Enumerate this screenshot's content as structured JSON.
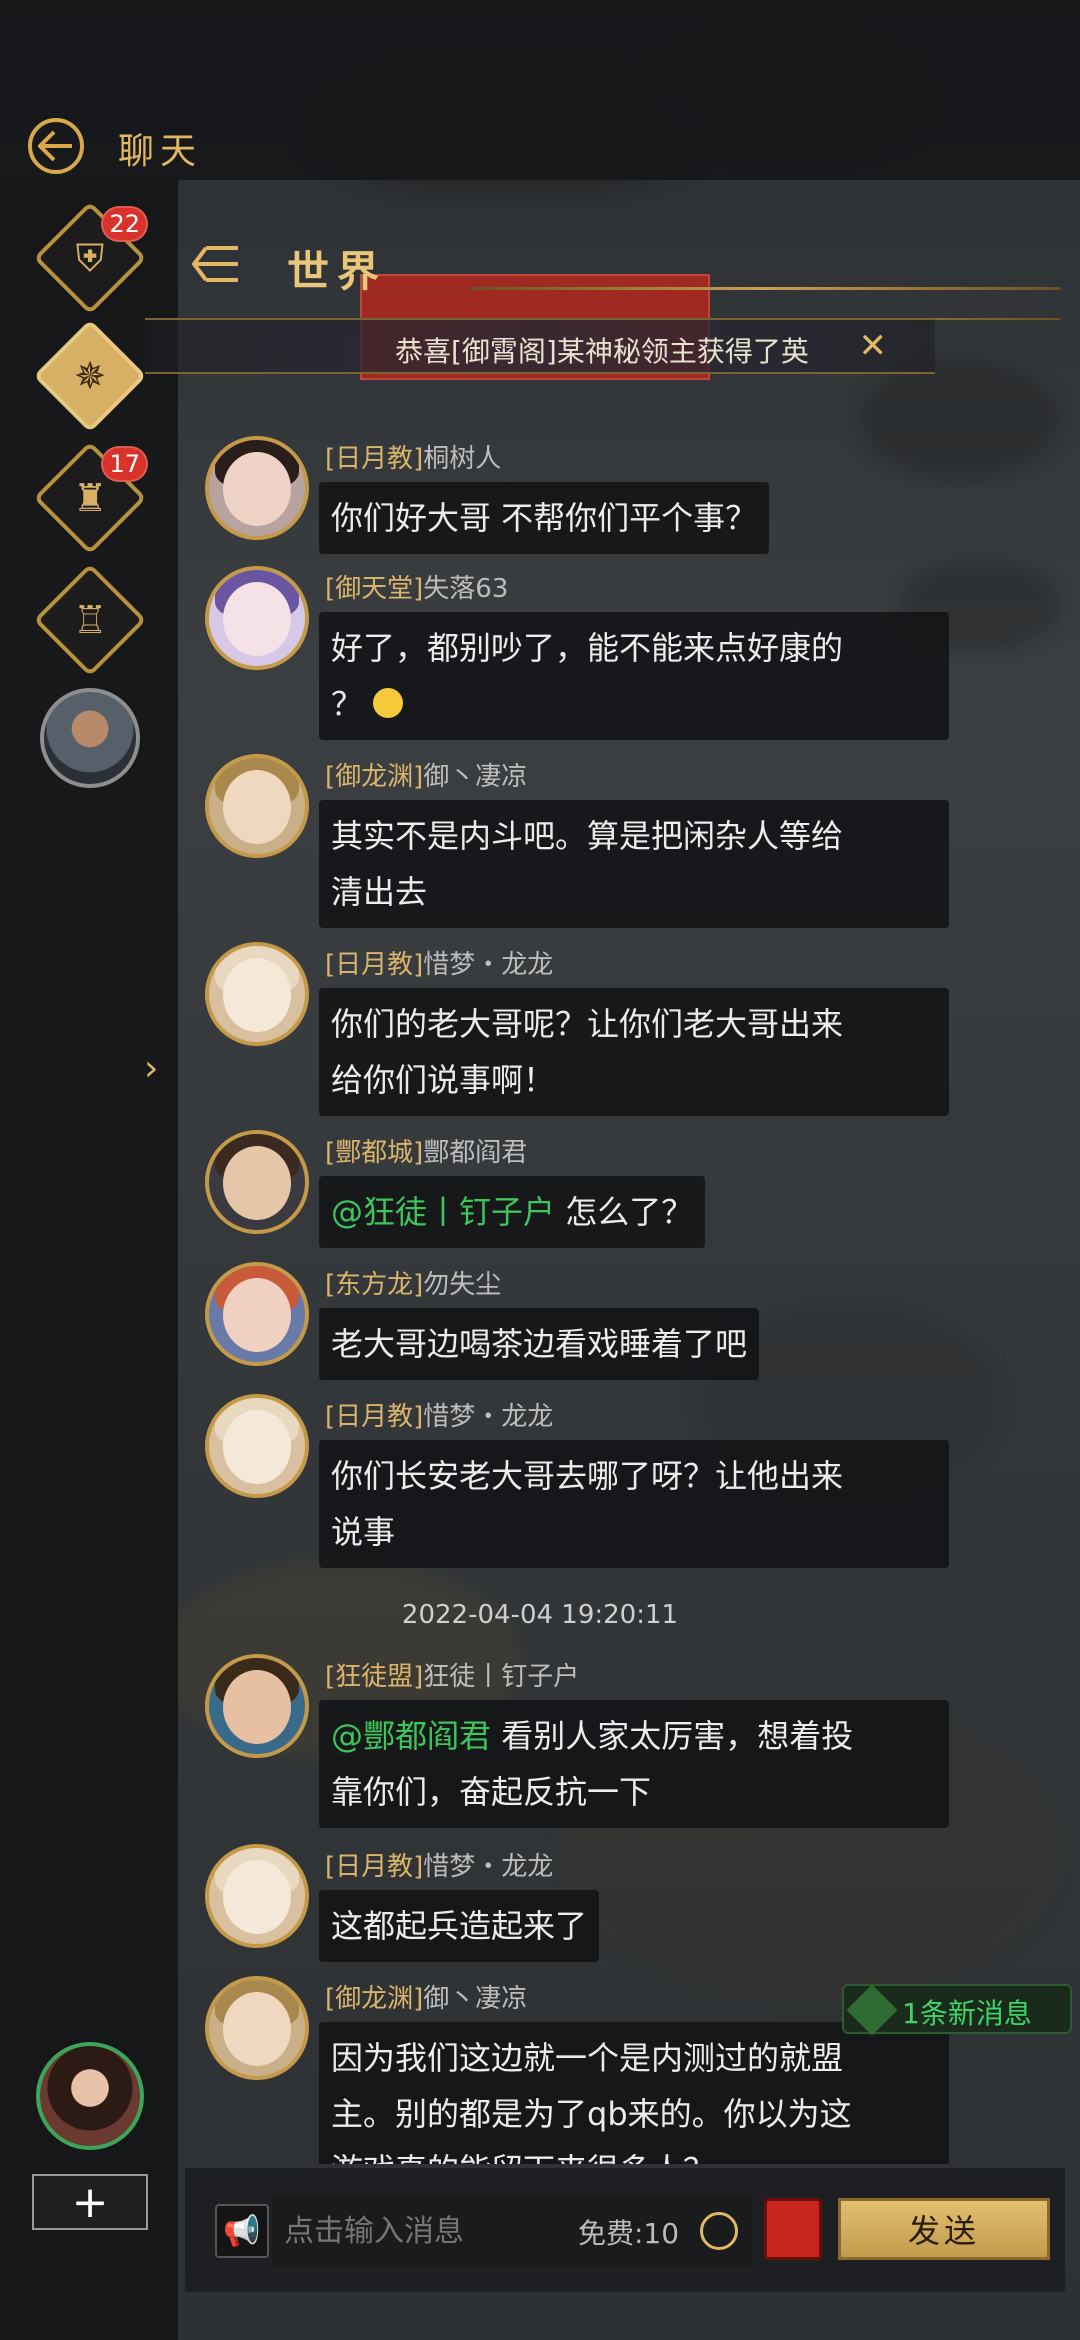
{
  "header": {
    "title": "聊天"
  },
  "sidebar": {
    "items": [
      {
        "name": "alliance",
        "badge": "22"
      },
      {
        "name": "world",
        "badge": ""
      },
      {
        "name": "city",
        "badge": "17"
      },
      {
        "name": "castle",
        "badge": ""
      }
    ],
    "expand_icon": "chevron-right-icon",
    "add_label": "+"
  },
  "channel": {
    "title": "世界",
    "marquee": "恭喜[御霄阁]某神秘领主获得了英"
  },
  "messages": [
    {
      "guild": "[日月教]",
      "name": "桐树人",
      "text": "你们好大哥 不帮你们平个事？"
    },
    {
      "guild": "[御天堂]",
      "name": "失落63",
      "text": "好了，都别吵了，能不能来点好康的？"
    },
    {
      "guild": "[御龙渊]",
      "name": "御丶凄凉",
      "line1": "其实不是内斗吧。算是把闲杂人等给",
      "line2": "清出去"
    },
    {
      "guild": "[日月教]",
      "name": "惜梦・龙龙",
      "line1": "你们的老大哥呢？让你们老大哥出来",
      "line2": "给你们说事啊！"
    },
    {
      "guild": "[酆都城]",
      "name": "酆都阎君",
      "mention": "@狂徒丨钉子户",
      "text": "怎么了？"
    },
    {
      "guild": "[东方龙]",
      "name": "勿失尘",
      "text": "老大哥边喝茶边看戏睡着了吧"
    },
    {
      "guild": "[日月教]",
      "name": "惜梦・龙龙",
      "line1": "你们长安老大哥去哪了呀？让他出来",
      "line2": "说事"
    },
    {
      "guild": "[狂徒盟]",
      "name": "狂徒丨钉子户",
      "mention": "@酆都阎君",
      "text": "看别人家太厉害，想着投",
      "line2": "靠你们，奋起反抗一下"
    },
    {
      "guild": "[日月教]",
      "name": "惜梦・龙龙",
      "text": "这都起兵造起来了"
    },
    {
      "guild": "[御龙渊]",
      "name": "御丶凄凉",
      "line1": "因为我们这边就一个是内测过的就盟",
      "line2": "主。别的都是为了qb来的。你以为这",
      "line3": "游戏真的能留下来很多人？"
    }
  ],
  "msg2": {
    "line1": "好了，都别吵了，能不能来点好康的",
    "line2": "？"
  },
  "timestamp": "2022-04-04 19:20:11",
  "new_message": "1条新消息",
  "input": {
    "placeholder": "点击输入消息",
    "free": "免费:10",
    "send": "发送"
  },
  "colors": {
    "gold": "#e2b863",
    "mention": "#3cc65b",
    "badge": "#d8322b"
  }
}
